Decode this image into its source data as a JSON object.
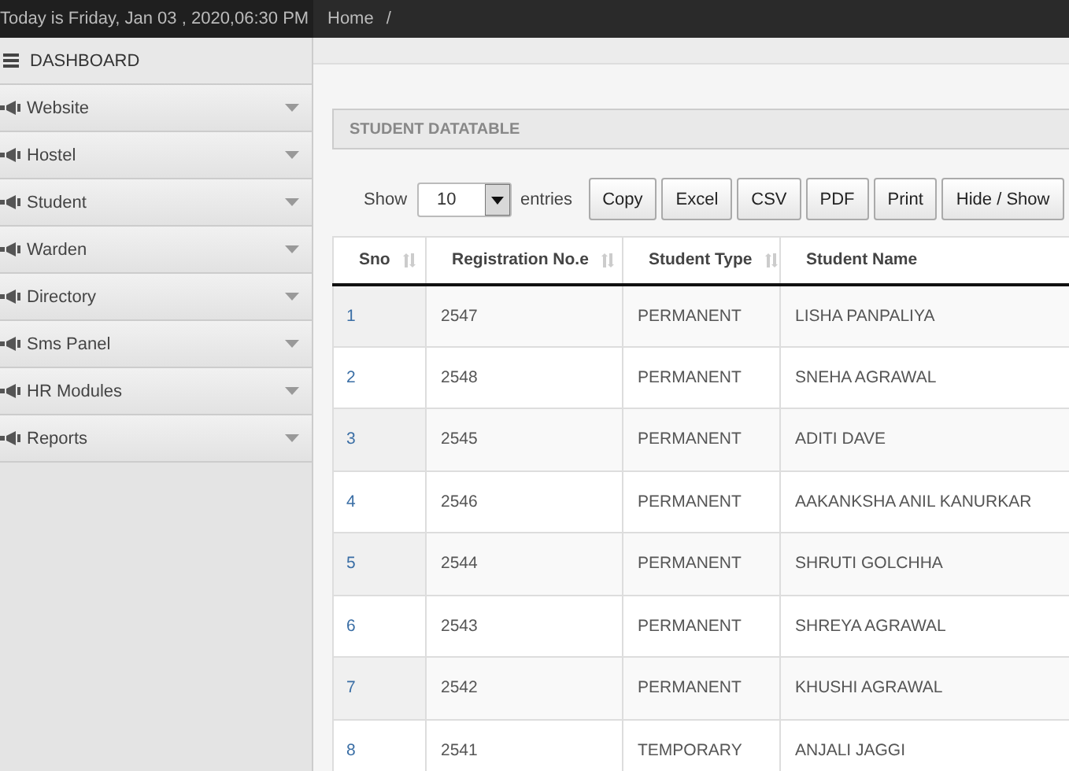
{
  "top_bar": {
    "date_text": "Today is Friday, Jan 03 , 2020,06:30 PM",
    "breadcrumb": [
      "Home",
      "/"
    ]
  },
  "sidebar": {
    "header": "DASHBOARD",
    "items": [
      {
        "label": "Website"
      },
      {
        "label": "Hostel"
      },
      {
        "label": "Student"
      },
      {
        "label": "Warden"
      },
      {
        "label": "Directory"
      },
      {
        "label": "Sms Panel"
      },
      {
        "label": "HR Modules"
      },
      {
        "label": "Reports"
      }
    ]
  },
  "panel": {
    "title": "STUDENT DATATABLE"
  },
  "length_control": {
    "before": "Show",
    "value": "10",
    "after": "entries"
  },
  "buttons": [
    "Copy",
    "Excel",
    "CSV",
    "PDF",
    "Print",
    "Hide / Show"
  ],
  "table": {
    "columns": [
      {
        "label": "Sno",
        "sortable": true
      },
      {
        "label": "Registration No.e",
        "sortable": true
      },
      {
        "label": "Student Type",
        "sortable": true
      },
      {
        "label": "Student Name",
        "sortable": false
      }
    ],
    "rows": [
      [
        "1",
        "2547",
        "PERMANENT",
        "LISHA PANPALIYA"
      ],
      [
        "2",
        "2548",
        "PERMANENT",
        "SNEHA AGRAWAL"
      ],
      [
        "3",
        "2545",
        "PERMANENT",
        "ADITI DAVE"
      ],
      [
        "4",
        "2546",
        "PERMANENT",
        "AAKANKSHA ANIL KANURKAR"
      ],
      [
        "5",
        "2544",
        "PERMANENT",
        "SHRUTI GOLCHHA"
      ],
      [
        "6",
        "2543",
        "PERMANENT",
        "SHREYA AGRAWAL"
      ],
      [
        "7",
        "2542",
        "PERMANENT",
        "KHUSHI AGRAWAL"
      ],
      [
        "8",
        "2541",
        "TEMPORARY",
        "ANJALI JAGGI"
      ]
    ]
  }
}
